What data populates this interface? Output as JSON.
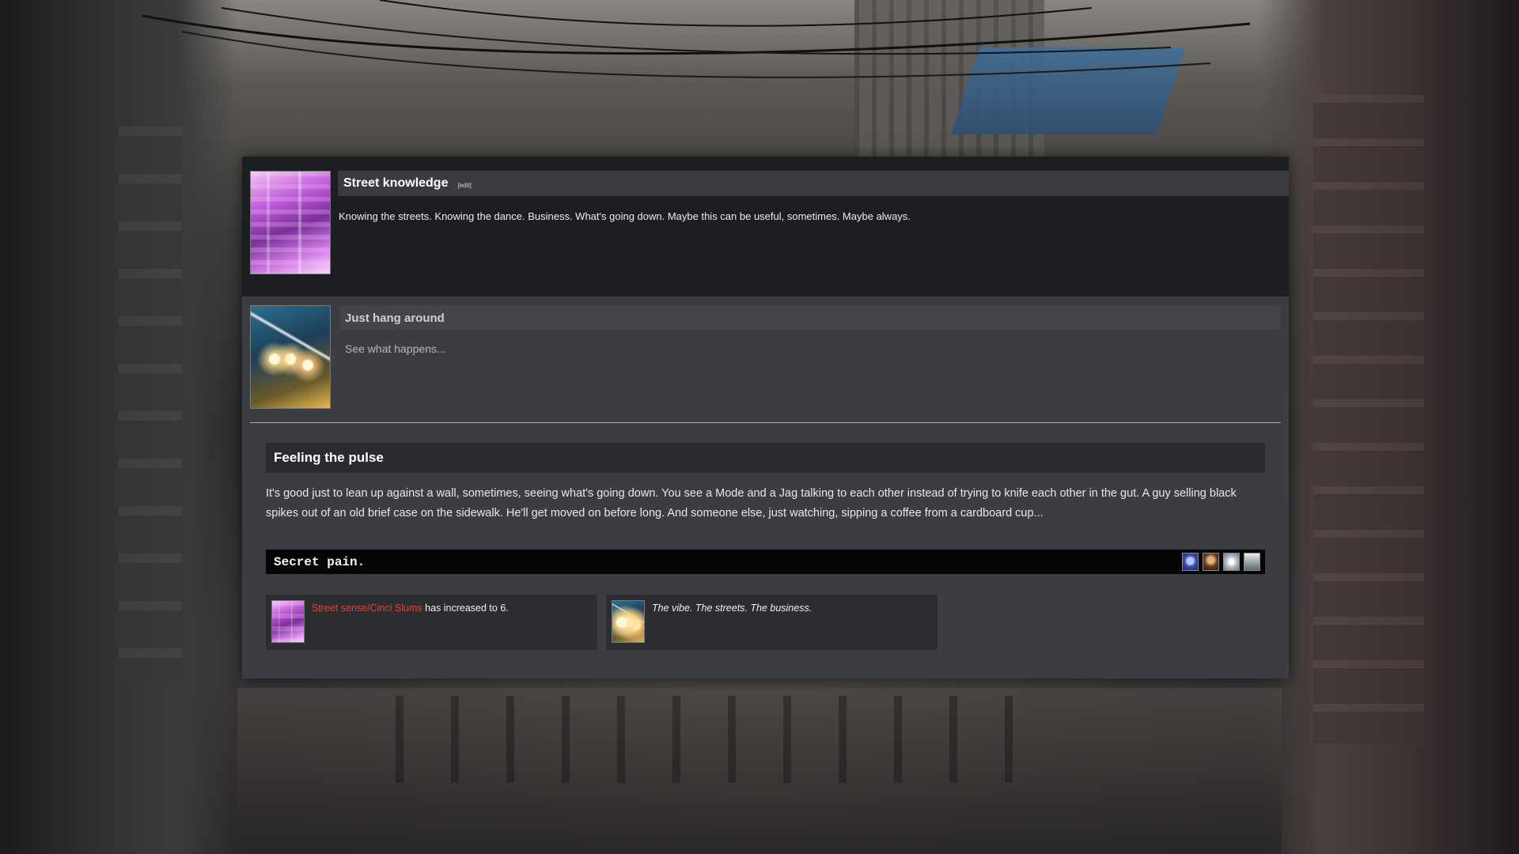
{
  "skill": {
    "title": "Street knowledge",
    "edit_label": "[edit]",
    "description": "Knowing the streets. Knowing the dance. Business. What's going down. Maybe this can be useful, sometimes. Maybe always."
  },
  "action": {
    "title": "Just hang around",
    "subtitle": "See what happens..."
  },
  "story": {
    "title": "Feeling the pulse",
    "text": "It's good just to lean up against a wall, sometimes, seeing what's going down. You see a Mode and a Jag talking to each other instead of trying to knife each other in the gut. A guy selling black spikes out of an old brief case on the sidewalk. He'll get moved on before long. And someone else, just watching, sipping a coffee from a cardboard cup..."
  },
  "secret": {
    "text": "Secret pain.",
    "icons": [
      "blue-orb-icon",
      "brown-figure-icon",
      "white-swirl-icon",
      "grey-card-icon"
    ]
  },
  "notices": [
    {
      "link_text": "Street sense/Cinci Slums",
      "text": "has increased to 6.",
      "link_color": "#e0453a"
    },
    {
      "text": "The vibe. The streets. The business."
    }
  ]
}
